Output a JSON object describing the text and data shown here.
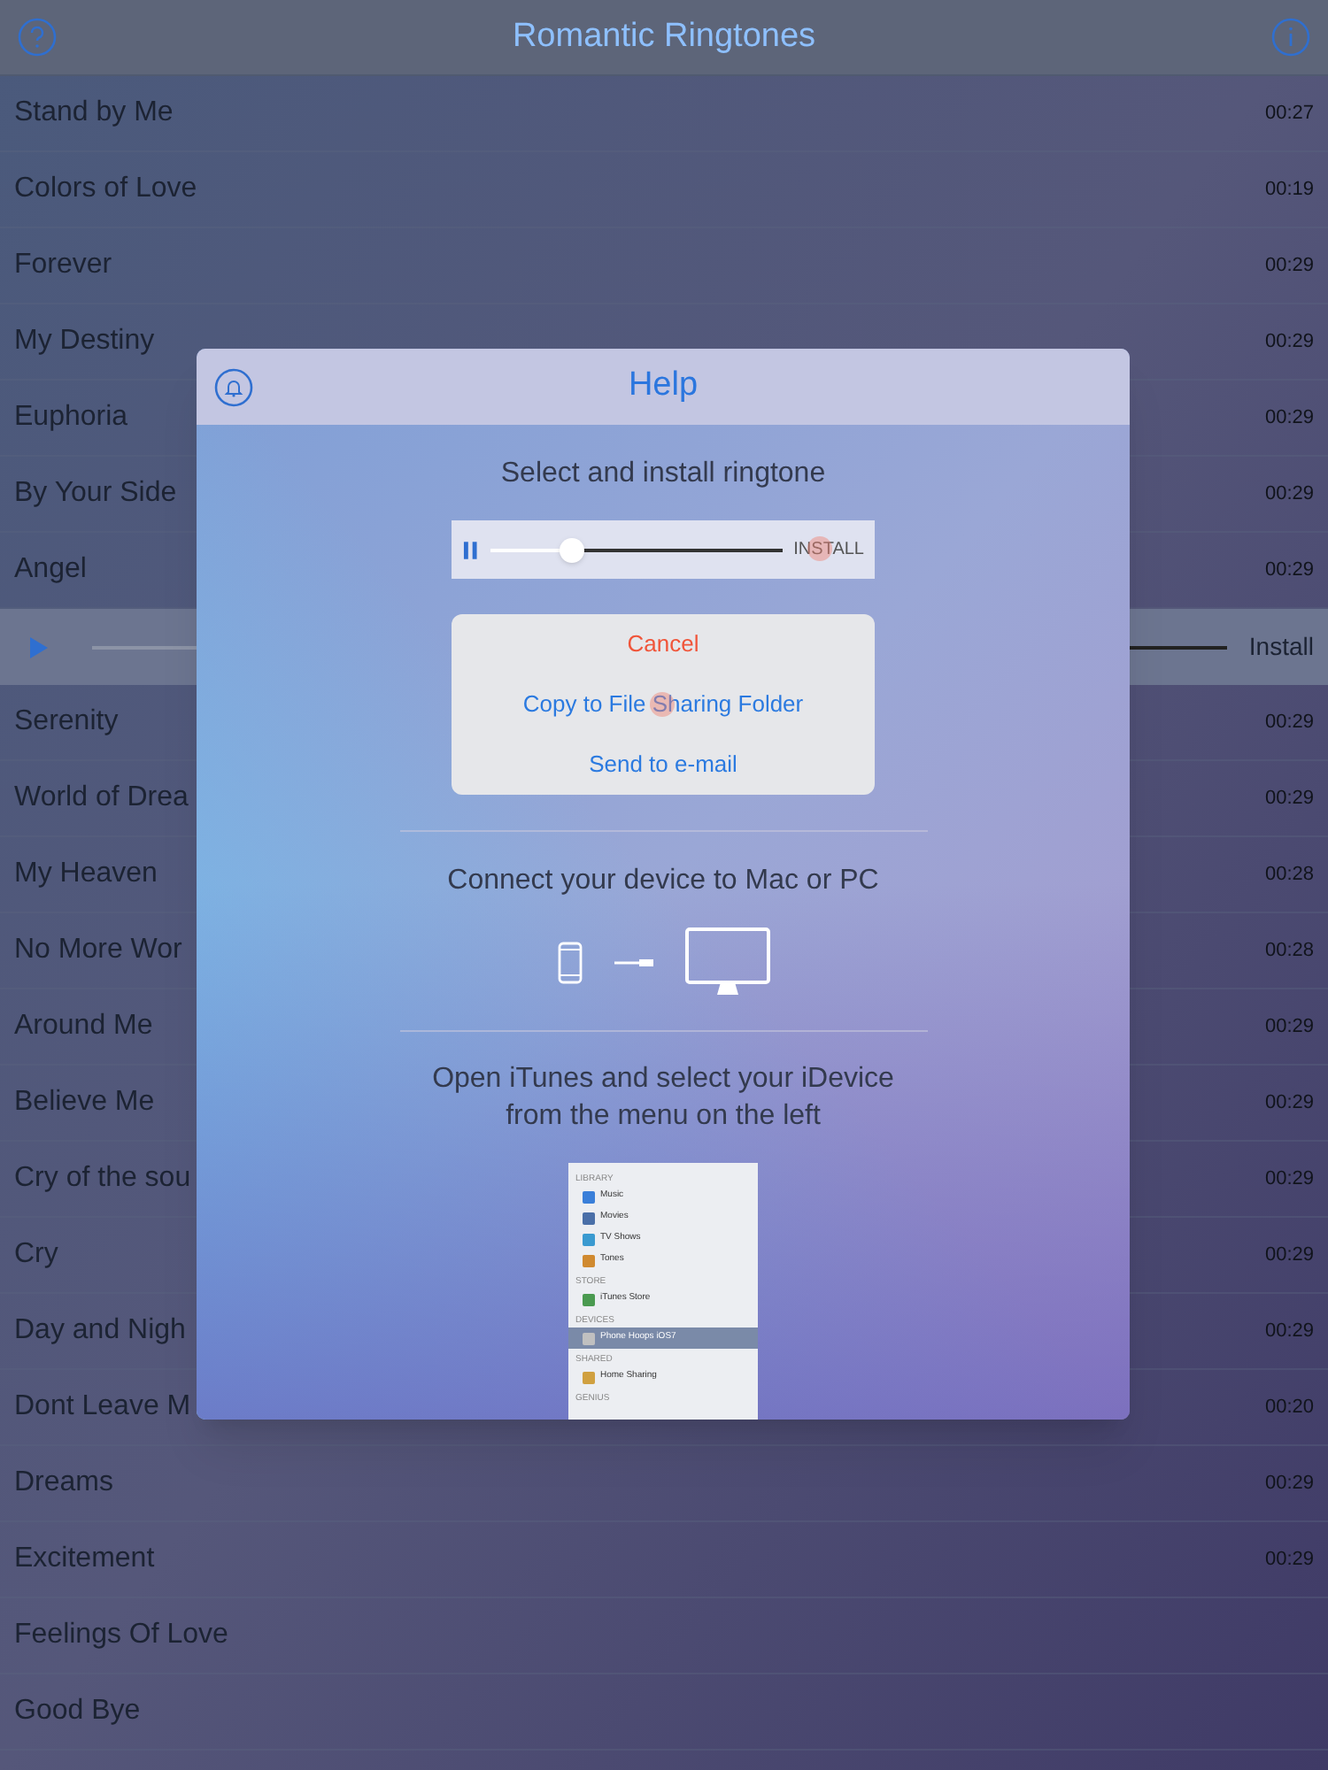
{
  "nav_bar": {
    "title": "Romantic Ringtones"
  },
  "ringtones": [
    {
      "kind": "track",
      "title": "Stand by Me",
      "duration": "00:27"
    },
    {
      "kind": "track",
      "title": "Colors of Love",
      "duration": "00:19"
    },
    {
      "kind": "track",
      "title": "Forever",
      "duration": "00:29"
    },
    {
      "kind": "track",
      "title": "My Destiny",
      "duration": "00:29"
    },
    {
      "kind": "track",
      "title": "Euphoria",
      "duration": "00:29"
    },
    {
      "kind": "track",
      "title": "By Your Side",
      "duration": "00:29"
    },
    {
      "kind": "track",
      "title": "Angel",
      "duration": "00:29"
    },
    {
      "kind": "player",
      "install": "Install"
    },
    {
      "kind": "track",
      "title": "Serenity",
      "duration": "00:29"
    },
    {
      "kind": "track",
      "title": "World of Drea",
      "duration": "00:29"
    },
    {
      "kind": "track",
      "title": "My Heaven",
      "duration": "00:28"
    },
    {
      "kind": "track",
      "title": "No More Wor",
      "duration": "00:28"
    },
    {
      "kind": "track",
      "title": "Around Me",
      "duration": "00:29"
    },
    {
      "kind": "track",
      "title": "Believe Me",
      "duration": "00:29"
    },
    {
      "kind": "track",
      "title": "Cry of the sou",
      "duration": "00:29"
    },
    {
      "kind": "track",
      "title": "Cry",
      "duration": "00:29"
    },
    {
      "kind": "track",
      "title": "Day and Nigh",
      "duration": "00:29"
    },
    {
      "kind": "track",
      "title": "Dont Leave M",
      "duration": "00:20"
    },
    {
      "kind": "track",
      "title": "Dreams",
      "duration": "00:29"
    },
    {
      "kind": "track",
      "title": "Excitement",
      "duration": "00:29"
    },
    {
      "kind": "track",
      "title": "Feelings Of Love"
    },
    {
      "kind": "track",
      "title": "Good Bye"
    }
  ],
  "help_dialog": {
    "title": "Help",
    "step_1": "Select and install ringtone",
    "player": {
      "level": 0.28,
      "install": "INSTALL"
    },
    "action_sheet": [
      {
        "kind": "destructive",
        "label": "Cancel"
      },
      {
        "kind": "default",
        "label": "Copy to File Sharing Folder"
      },
      {
        "kind": "default",
        "label": "Send to e-mail"
      }
    ],
    "step_2": "Connect your device to Mac or PC",
    "step_3": [
      "Open iTunes and select your iDevice",
      "from the menu on the left"
    ],
    "itunes_sidebar": [
      {
        "kind": "header",
        "label": "LIBRARY"
      },
      {
        "kind": "item",
        "label": "Music"
      },
      {
        "kind": "item",
        "label": "Movies"
      },
      {
        "kind": "item",
        "label": "TV Shows"
      },
      {
        "kind": "item",
        "label": "Tones"
      },
      {
        "kind": "header",
        "label": "STORE"
      },
      {
        "kind": "item",
        "label": "iTunes Store"
      },
      {
        "kind": "header",
        "label": "DEVICES"
      },
      {
        "kind": "device",
        "label": "Phone Hoops iOS7",
        "selected": true
      },
      {
        "kind": "header",
        "label": "SHARED"
      },
      {
        "kind": "item",
        "label": "Home Sharing"
      },
      {
        "kind": "header",
        "label": "GENIUS"
      }
    ]
  }
}
